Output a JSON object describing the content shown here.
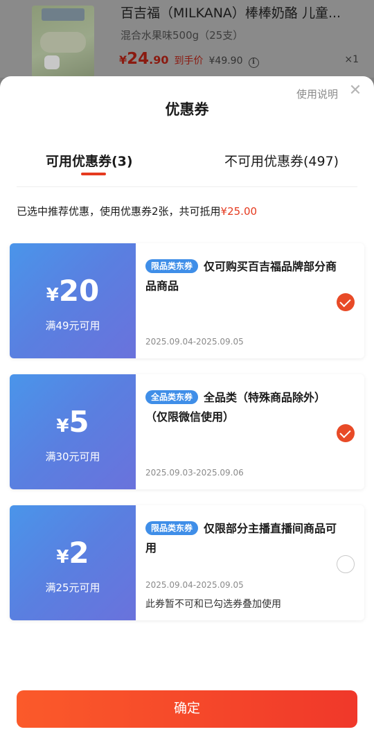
{
  "product": {
    "title": "百吉福（MILKANA）棒棒奶酪 儿童...",
    "spec": "混合水果味500g（25支）",
    "price_currency": "¥",
    "price_int": "24",
    "price_dec": ".90",
    "price_tag": "到手价",
    "original_price": "¥49.90",
    "quantity": "×1"
  },
  "sheet": {
    "title": "优惠券",
    "help_link": "使用说明",
    "close_icon": "close-icon"
  },
  "tabs": {
    "available": "可用优惠券(3)",
    "unavailable": "不可用优惠券(497)"
  },
  "summary": {
    "text": "已选中推荐优惠，使用优惠券2张，共可抵用",
    "amount": "¥25.00"
  },
  "coupons": [
    {
      "yen": "¥",
      "amount": "20",
      "condition": "满49元可用",
      "badge": "限品类东券",
      "description": "仅可购买百吉福品牌部分商品商品",
      "date": "2025.09.04-2025.09.05",
      "selected": true
    },
    {
      "yen": "¥",
      "amount": "5",
      "condition": "满30元可用",
      "badge": "全品类东券",
      "description": "全品类（特殊商品除外）（仅限微信使用）",
      "date": "2025.09.03-2025.09.06",
      "selected": true
    },
    {
      "yen": "¥",
      "amount": "2",
      "condition": "满25元可用",
      "badge": "限品类东券",
      "description": "仅限部分主播直播间商品可用",
      "date": "2025.09.04-2025.09.05",
      "note": "此券暂不可和已勾选券叠加使用",
      "selected": false
    }
  ],
  "confirm_label": "确定",
  "colors": {
    "accent": "#e53a1f",
    "coupon_gradient_start": "#4a95ea",
    "coupon_gradient_end": "#6a72dc",
    "badge": "#3f8ee8"
  }
}
